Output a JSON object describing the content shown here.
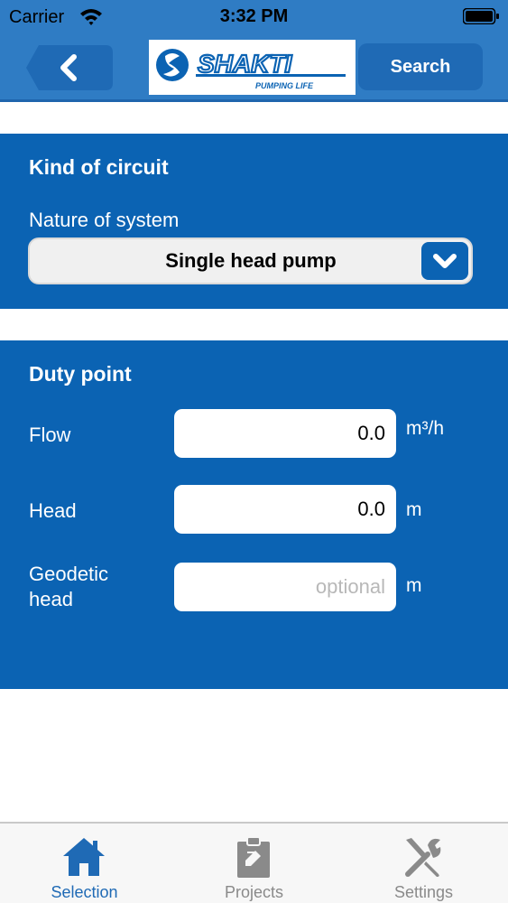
{
  "status_bar": {
    "carrier": "Carrier",
    "time": "3:32 PM"
  },
  "nav": {
    "back_icon": "chevron-left-icon",
    "logo_text": "SHAKTI",
    "logo_tagline": "PUMPING LIFE",
    "search_label": "Search"
  },
  "circuit": {
    "title": "Kind of circuit",
    "nature_label": "Nature of system",
    "nature_value": "Single head pump"
  },
  "duty": {
    "title": "Duty point",
    "flow_label": "Flow",
    "flow_value": "0.0",
    "flow_unit": "m³/h",
    "head_label": "Head",
    "head_value": "0.0",
    "head_unit": "m",
    "geodetic_label_line1": "Geodetic",
    "geodetic_label_line2": "head",
    "geodetic_placeholder": "optional",
    "geodetic_unit": "m"
  },
  "tabs": [
    {
      "label": "Selection",
      "icon": "home-icon",
      "active": true
    },
    {
      "label": "Projects",
      "icon": "clipboard-icon",
      "active": false
    },
    {
      "label": "Settings",
      "icon": "tools-icon",
      "active": false
    }
  ],
  "colors": {
    "header": "#2f7cc4",
    "panel": "#0b63b3",
    "active_tab": "#1f6ab5"
  }
}
